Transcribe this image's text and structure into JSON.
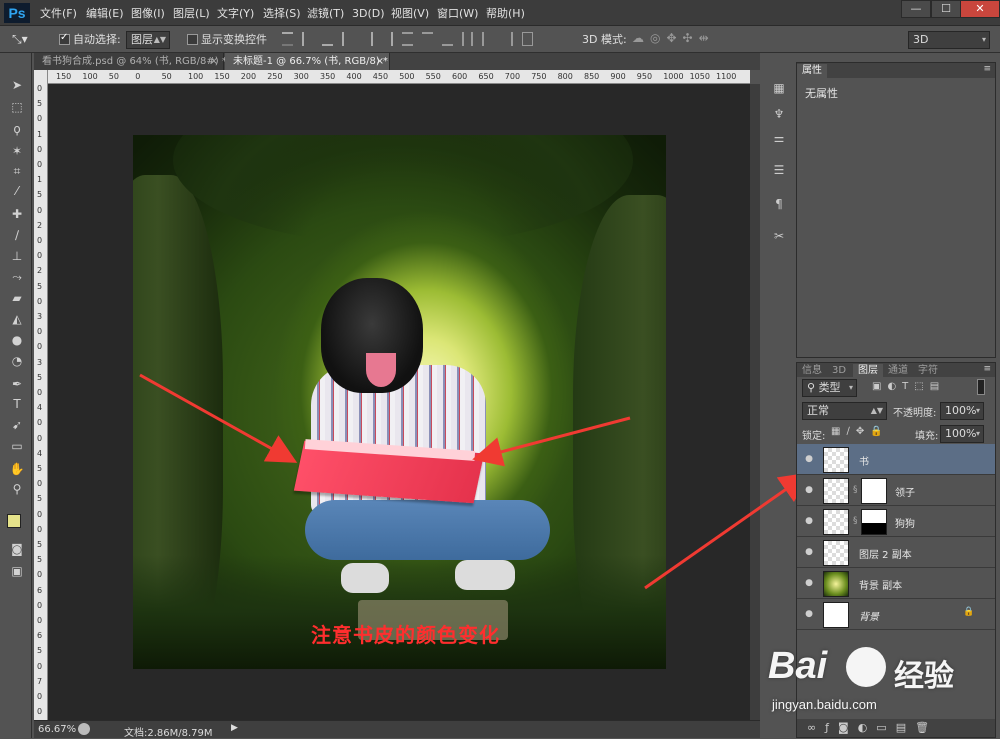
{
  "app": {
    "logo": "Ps"
  },
  "menu": [
    "文件(F)",
    "编辑(E)",
    "图像(I)",
    "图层(L)",
    "文字(Y)",
    "选择(S)",
    "滤镜(T)",
    "3D(D)",
    "视图(V)",
    "窗口(W)",
    "帮助(H)"
  ],
  "window_controls": {
    "minimize": "—",
    "maximize": "☐",
    "close": "✕"
  },
  "options": {
    "auto_select_label": "自动选择:",
    "auto_select_checked": true,
    "auto_select_target": "图层",
    "show_transform_label": "显示变换控件",
    "show_transform_checked": false,
    "mode_3d_label": "3D 模式:",
    "workspace": "3D"
  },
  "tabs": [
    {
      "label": "看书狗合成.psd @ 64% (书, RGB/8#) *",
      "close": "×",
      "active": false
    },
    {
      "label": "未标题-1 @ 66.7% (书, RGB/8) *",
      "close": "×",
      "active": true
    }
  ],
  "ruler_top": [
    "150",
    "100",
    "50",
    "0",
    "50",
    "100",
    "150",
    "200",
    "250",
    "300",
    "350",
    "400",
    "450",
    "500",
    "550",
    "600",
    "650",
    "700",
    "750",
    "800",
    "850",
    "900",
    "950",
    "1000",
    "1050",
    "1100"
  ],
  "ruler_left": [
    "0",
    "5",
    "0",
    "1",
    "0",
    "0",
    "1",
    "5",
    "0",
    "2",
    "0",
    "0",
    "2",
    "5",
    "0",
    "3",
    "0",
    "0",
    "3",
    "5",
    "0",
    "4",
    "0",
    "0",
    "4",
    "5",
    "0",
    "5",
    "0",
    "0",
    "5",
    "5",
    "0",
    "6",
    "0",
    "0",
    "6",
    "5",
    "0",
    "7",
    "0",
    "0"
  ],
  "status": {
    "zoom": "66.67%",
    "doc_label": "文档:2.86M/8.79M"
  },
  "properties": {
    "tab": "属性",
    "content": "无属性"
  },
  "layers_panel": {
    "tabs": [
      "信息",
      "3D",
      "图层",
      "通道",
      "字符"
    ],
    "active_tab": "图层",
    "filter": "类型",
    "blend_mode": "正常",
    "opacity_label": "不透明度:",
    "opacity": "100%",
    "lock_label": "锁定:",
    "fill_label": "填充:",
    "fill": "100%",
    "layers": [
      {
        "name": "书",
        "selected": true,
        "has_mask": false,
        "locked": false
      },
      {
        "name": "领子",
        "selected": false,
        "has_mask": true,
        "locked": false
      },
      {
        "name": "狗狗",
        "selected": false,
        "has_mask": true,
        "locked": false
      },
      {
        "name": "图层 2 副本",
        "selected": false,
        "has_mask": false,
        "locked": false
      },
      {
        "name": "背景 副本",
        "selected": false,
        "has_mask": false,
        "locked": false
      },
      {
        "name": "背景",
        "selected": false,
        "has_mask": false,
        "locked": true
      }
    ]
  },
  "annotation": {
    "text": "注意书皮的颜色变化",
    "color": "#ff2e2e"
  },
  "watermark": {
    "brand": "Bai",
    "brand2": "经验",
    "url": "jingyan.baidu.com"
  },
  "colors": {
    "accent_selected": "#5c6e86",
    "book": "#e8344e",
    "arrow": "#f03a32",
    "foreground_swatch": "#e5e28a"
  }
}
